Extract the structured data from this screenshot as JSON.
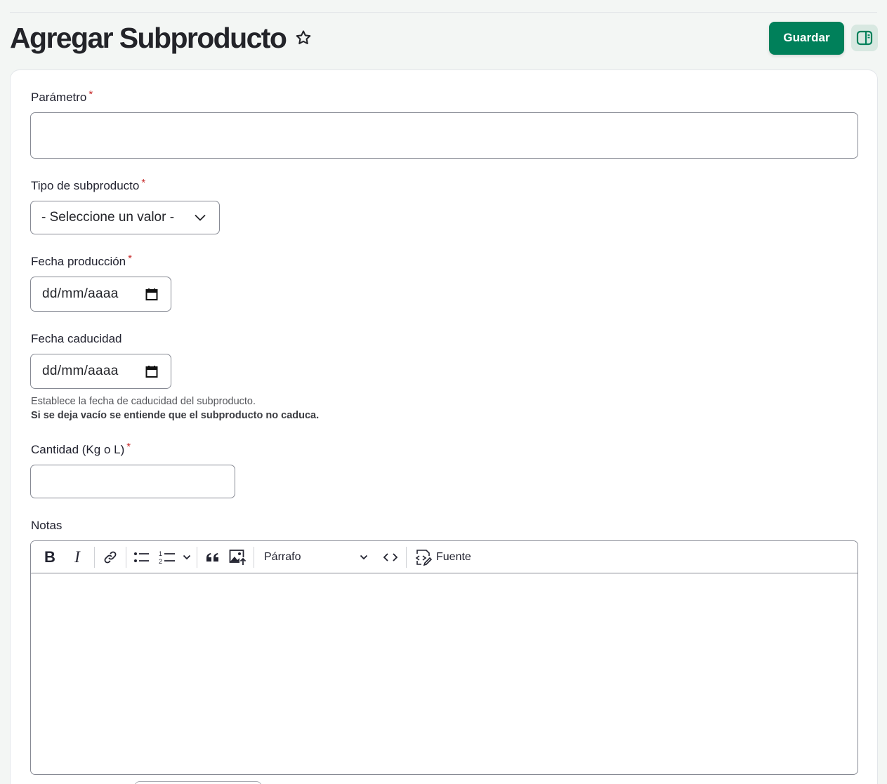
{
  "header": {
    "title": "Agregar Subproducto",
    "save_label": "Guardar"
  },
  "form": {
    "parametro": {
      "label": "Parámetro",
      "required_mark": "*",
      "value": ""
    },
    "tipo": {
      "label": "Tipo de subproducto",
      "required_mark": "*",
      "selected": "- Seleccione un valor -"
    },
    "fecha_produccion": {
      "label": "Fecha producción",
      "required_mark": "*",
      "placeholder": "dd/mm/aaaa"
    },
    "fecha_caducidad": {
      "label": "Fecha caducidad",
      "placeholder": "dd/mm/aaaa",
      "help": "Establece la fecha de caducidad del subproducto.",
      "help_strong": "Si se deja vacío se entiende que el subproducto no caduca."
    },
    "cantidad": {
      "label": "Cantidad (Kg o L)",
      "required_mark": "*",
      "value": ""
    },
    "notas": {
      "label": "Notas",
      "toolbar": {
        "bold": "B",
        "italic": "I",
        "heading": "Párrafo",
        "source": "Fuente"
      }
    }
  },
  "colors": {
    "primary": "#00805a",
    "required": "#c72d2d",
    "toggle_bg": "#d8e8e1"
  },
  "icons": [
    "star-icon",
    "sidebar-toggle-icon",
    "chevron-down-icon",
    "calendar-icon",
    "link-icon",
    "bulleted-list-icon",
    "numbered-list-icon",
    "blockquote-icon",
    "image-upload-icon",
    "code-icon",
    "source-icon"
  ]
}
